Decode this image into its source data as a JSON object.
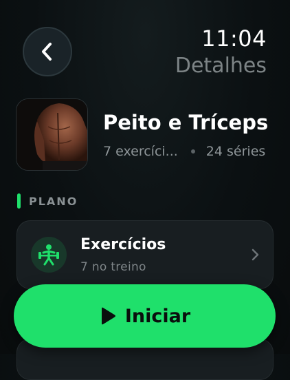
{
  "header": {
    "time": "11:04",
    "title": "Detalhes",
    "back_icon": "chevron-left-icon"
  },
  "workout": {
    "title": "Peito e Tríceps",
    "exercises_summary": "7 exercíci...",
    "series_summary": "24 séries",
    "image": "back-muscles-photo"
  },
  "plan": {
    "section_label": "PLANO",
    "card": {
      "title": "Exercícios",
      "subtitle": "7 no treino",
      "icon": "weightlifter-icon"
    }
  },
  "actions": {
    "start_label": "Iniciar",
    "start_icon": "play-icon"
  },
  "colors": {
    "accent": "#1fe06b",
    "background": "#0b1012",
    "card": "#181e21",
    "muted_text": "#7d8486"
  }
}
